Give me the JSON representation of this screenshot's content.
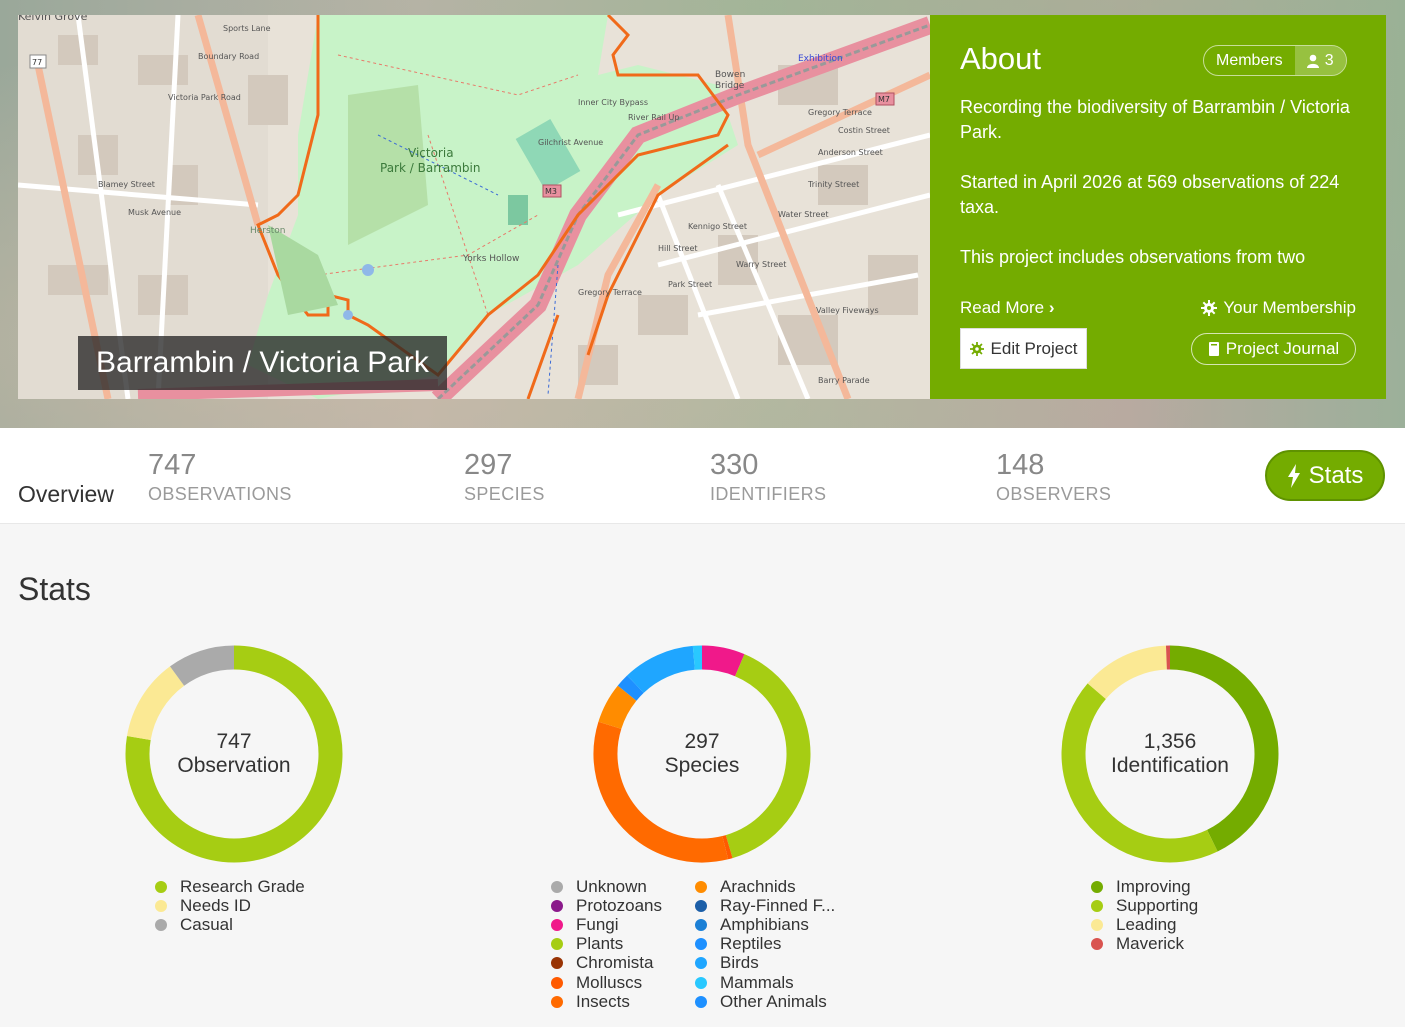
{
  "project": {
    "title": "Barrambin / Victoria Park"
  },
  "about": {
    "heading": "About",
    "members_label": "Members",
    "members_count": "3",
    "paragraphs": [
      "Recording the biodiversity of Barrambin / Victoria Park.",
      "Started in April 2026 at 569 observations of 224 taxa.",
      "This project includes observations from two"
    ],
    "read_more": "Read More",
    "your_membership": "Your Membership",
    "edit_project": "Edit Project",
    "project_journal": "Project Journal"
  },
  "map": {
    "labels": [
      "Victoria",
      "Park / Barrambin",
      "Yorks Hollow",
      "Exhibition",
      "Bowen",
      "Bridge",
      "Inner City Bypass",
      "Gregory Terrace",
      "Water Street",
      "Valley Fiveways",
      "Barry Parade",
      "Musk Avenue",
      "Blamey Street",
      "Kelvin Grove",
      "Herston",
      "Gilchrist Avenue",
      "Victoria Park Road",
      "Hill Street",
      "Park Street",
      "Kennigo Street",
      "Warry Street",
      "Anderson Street",
      "Costin Street",
      "Trinity Street",
      "Sports Lane",
      "Boundary Road",
      "River Rail Up"
    ],
    "shields": [
      "77",
      "M3",
      "M7"
    ]
  },
  "tabs": {
    "overview": "Overview",
    "stats": [
      {
        "value": "747",
        "label": "OBSERVATIONS"
      },
      {
        "value": "297",
        "label": "SPECIES"
      },
      {
        "value": "330",
        "label": "IDENTIFIERS"
      },
      {
        "value": "148",
        "label": "OBSERVERS"
      }
    ],
    "stats_button": "Stats"
  },
  "stats_section": {
    "title": "Stats"
  },
  "chart_data": [
    {
      "type": "pie",
      "center_value": "747",
      "center_label": "Observation",
      "categories": [
        "Research Grade",
        "Needs ID",
        "Casual"
      ],
      "values": [
        580,
        92,
        75
      ],
      "colors": [
        "#a6cd13",
        "#fbe994",
        "#aaaaaa"
      ]
    },
    {
      "type": "pie",
      "center_value": "297",
      "center_label": "Species",
      "categories": [
        "Unknown",
        "Protozoans",
        "Fungi",
        "Plants",
        "Chromista",
        "Molluscs",
        "Insects",
        "Arachnids",
        "Ray-Finned F...",
        "Amphibians",
        "Reptiles",
        "Birds",
        "Mammals",
        "Other Animals"
      ],
      "values": [
        0,
        0,
        19,
        116,
        0,
        2,
        100,
        18,
        0,
        0,
        6,
        32,
        4,
        0
      ],
      "colors": [
        "#aaaaaa",
        "#8b1a8b",
        "#f0198a",
        "#a6cd13",
        "#993404",
        "#ff5a00",
        "#ff6a00",
        "#ff8c00",
        "#1c5fa8",
        "#1c80d6",
        "#1e90ff",
        "#1fa6ff",
        "#29c8ff",
        "#1e90ff"
      ]
    },
    {
      "type": "pie",
      "center_value": "1,356",
      "center_label": "Identification",
      "categories": [
        "Improving",
        "Supporting",
        "Leading",
        "Maverick"
      ],
      "values": [
        580,
        590,
        178,
        8
      ],
      "colors": [
        "#74ac00",
        "#a6cd13",
        "#fbe994",
        "#d9534f"
      ]
    }
  ]
}
